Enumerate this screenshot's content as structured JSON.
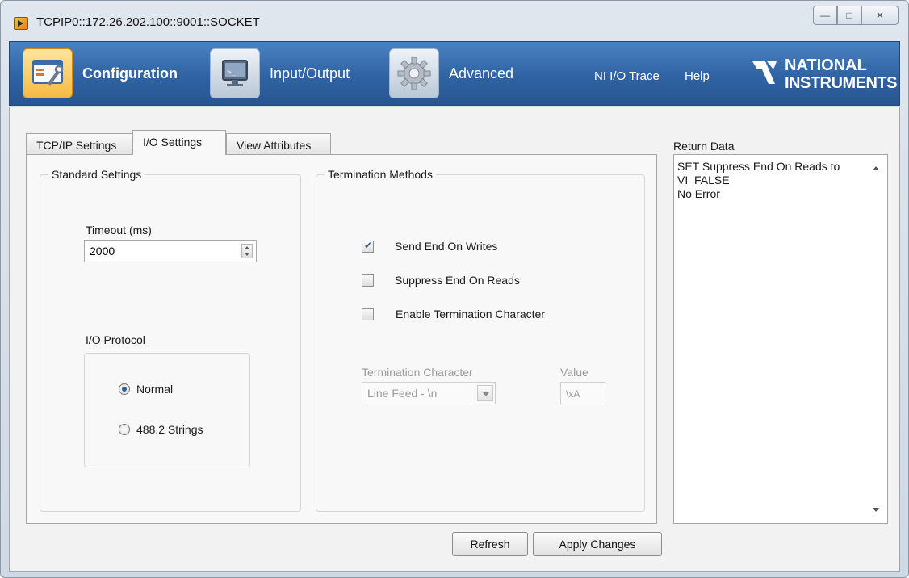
{
  "window": {
    "title": "TCPIP0::172.26.202.100::9001::SOCKET",
    "controls": {
      "minimize": "—",
      "maximize": "□",
      "close": "✕"
    }
  },
  "ribbon": {
    "buttons": [
      {
        "label": "Configuration",
        "icon": "configuration-icon",
        "active": true
      },
      {
        "label": "Input/Output",
        "icon": "monitor-icon",
        "active": false
      },
      {
        "label": "Advanced",
        "icon": "gear-icon",
        "active": false
      }
    ],
    "links": [
      "NI I/O Trace",
      "Help"
    ],
    "logo": {
      "line1": "NATIONAL",
      "line2": "INSTRUMENTS"
    }
  },
  "tabs": [
    {
      "label": "TCP/IP Settings",
      "selected": false
    },
    {
      "label": "I/O Settings",
      "selected": true
    },
    {
      "label": "View Attributes",
      "selected": false
    }
  ],
  "standard_settings": {
    "title": "Standard Settings",
    "timeout_label": "Timeout (ms)",
    "timeout_value": "2000",
    "protocol_label": "I/O Protocol",
    "protocols": [
      {
        "label": "Normal",
        "selected": true
      },
      {
        "label": "488.2 Strings",
        "selected": false
      }
    ]
  },
  "termination": {
    "title": "Termination Methods",
    "options": [
      {
        "label": "Send End On Writes",
        "checked": true
      },
      {
        "label": "Suppress End On Reads",
        "checked": false
      },
      {
        "label": "Enable Termination Character",
        "checked": false
      }
    ],
    "char_label": "Termination Character",
    "char_value": "Line Feed - \\n",
    "value_label": "Value",
    "value": "\\xA"
  },
  "return_data": {
    "label": "Return Data",
    "lines": [
      "SET Suppress End On Reads to",
      "VI_FALSE",
      "No Error"
    ]
  },
  "actions": {
    "refresh": "Refresh",
    "apply": "Apply Changes"
  },
  "colors": {
    "ribbon": "#2f63a3",
    "active_button": "#f5b942",
    "check": "#3a5f95"
  }
}
